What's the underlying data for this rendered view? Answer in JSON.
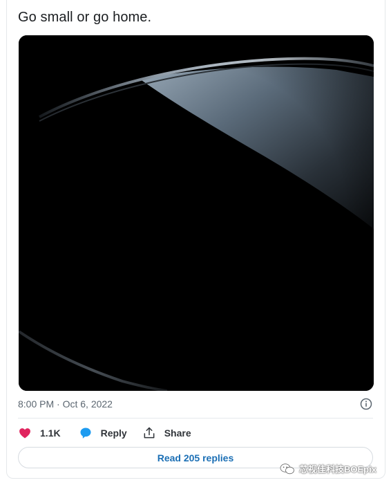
{
  "tweet": {
    "text": "Go small or go home.",
    "timestamp": "8:00 PM · Oct 6, 2022"
  },
  "media": {
    "description_icon": "image-media"
  },
  "actions": {
    "like_count": "1.1K",
    "reply_label": "Reply",
    "share_label": "Share"
  },
  "read_replies": {
    "label": "Read 205 replies"
  },
  "watermark": {
    "text": "芯视佳科技BOEpix"
  },
  "colors": {
    "like": "#e0245e",
    "reply": "#1d9bf0",
    "link": "#1b6fb5",
    "text": "#1b1e21",
    "muted": "#5b6670"
  }
}
